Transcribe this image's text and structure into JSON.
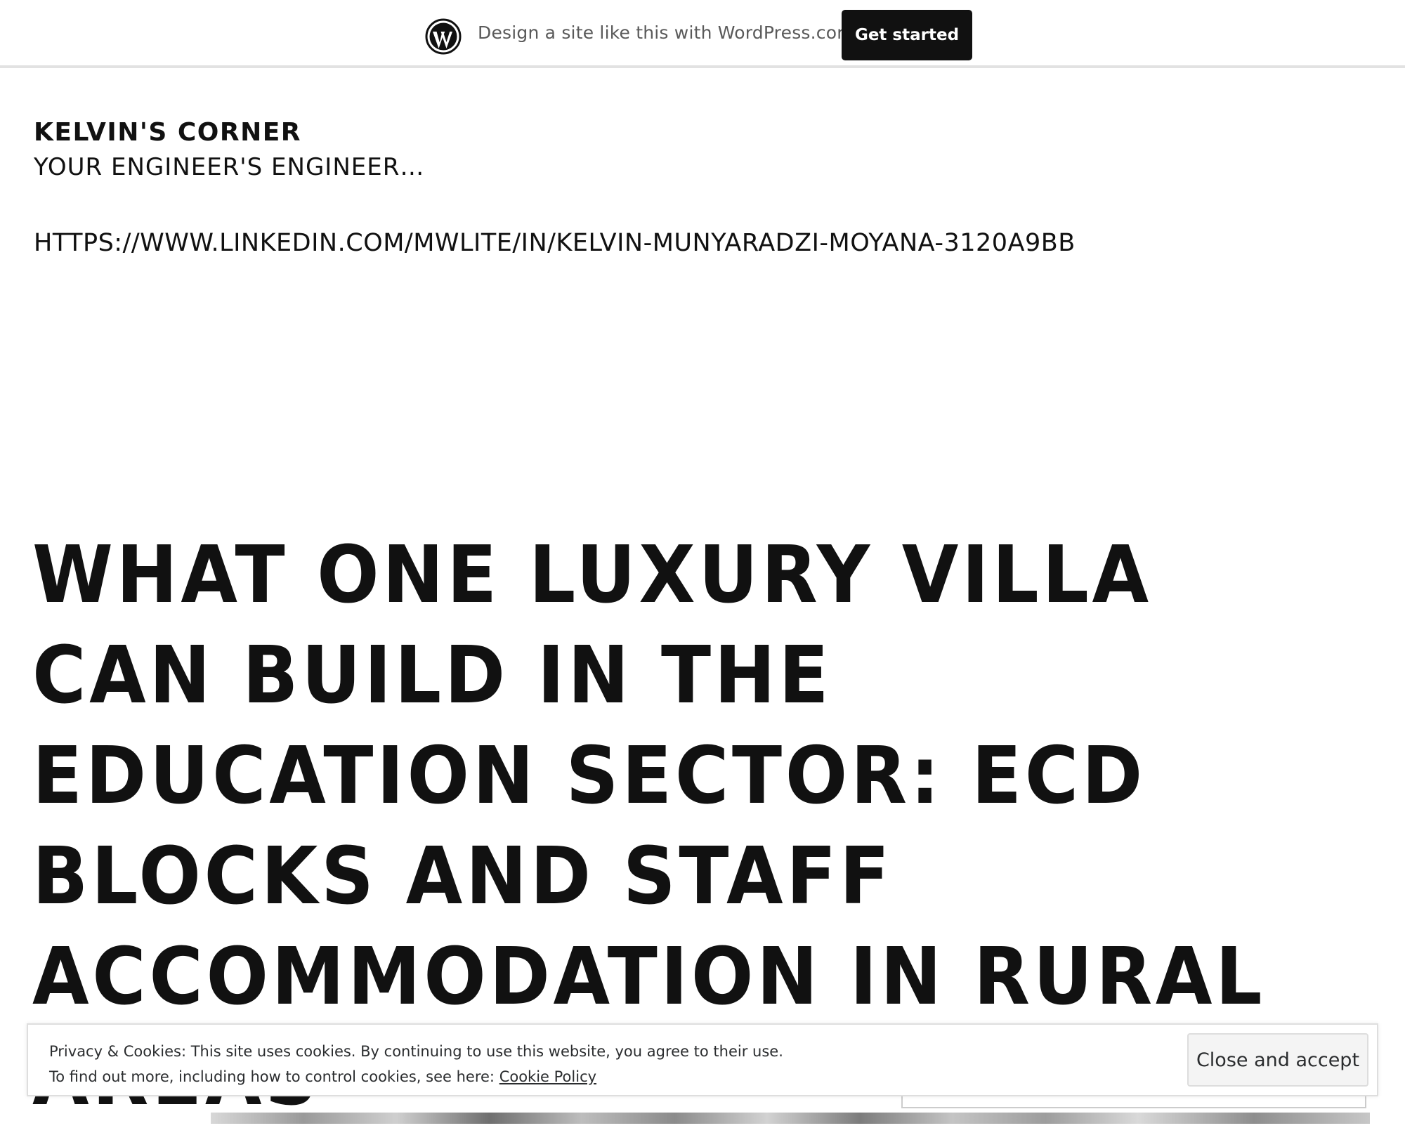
{
  "promo_bar": {
    "logo_icon": "wordpress-logo-icon",
    "text": "Design a site like this with WordPress.com",
    "button_label": "Get started"
  },
  "site": {
    "title": "KELVIN'S CORNER",
    "tagline": "YOUR ENGINEER'S ENGINEER…",
    "link_text": "HTTPS://WWW.LINKEDIN.COM/MWLITE/IN/KELVIN-MUNYARADZI-MOYANA-3120A9BB"
  },
  "post": {
    "title": "WHAT ONE LUXURY VILLA CAN BUILD IN THE EDUCATION SECTOR: ECD BLOCKS AND STAFF ACCOMMODATION IN RURAL AREAS"
  },
  "cookie_banner": {
    "line1": "Privacy & Cookies: This site uses cookies. By continuing to use this website, you agree to their use.",
    "line2_prefix": "To find out more, including how to control cookies, see here:",
    "link_label": "Cookie Policy",
    "accept_label": "Close and accept"
  },
  "colors": {
    "text": "#111111",
    "button_bg": "#111111",
    "button_text": "#ffffff",
    "banner_text": "#2b2d2f",
    "muted_text": "#5a5a5a"
  }
}
